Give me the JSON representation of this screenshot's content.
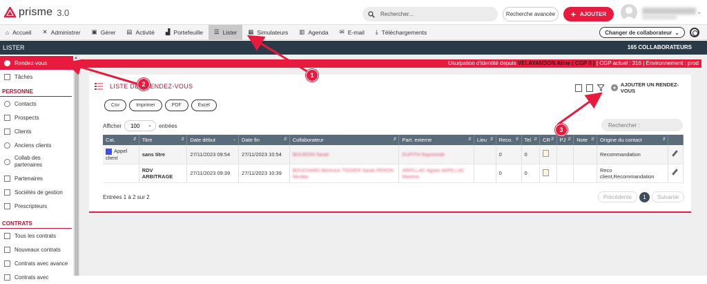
{
  "header": {
    "logo_text": "prisme",
    "version": "3.0",
    "search_placeholder": "Rechercher...",
    "advanced_search": "Recherche avancée",
    "add_label": "AJOUTER"
  },
  "nav": {
    "items": [
      {
        "label": "Accueil",
        "icon": "home-icon"
      },
      {
        "label": "Administrer",
        "icon": "tools-icon"
      },
      {
        "label": "Gérer",
        "icon": "briefcase-icon"
      },
      {
        "label": "Activité",
        "icon": "activity-icon"
      },
      {
        "label": "Portefeuille",
        "icon": "chart-icon"
      },
      {
        "label": "Lister",
        "icon": "list-icon"
      },
      {
        "label": "Simulateurs",
        "icon": "calculator-icon"
      },
      {
        "label": "Agenda",
        "icon": "calendar-icon"
      },
      {
        "label": "E-mail",
        "icon": "envelope-icon"
      },
      {
        "label": "Téléchargements",
        "icon": "download-icon"
      }
    ],
    "active": "Lister",
    "change_collaborator": "Changer de collaborateur"
  },
  "titlebar": {
    "section": "LISTER",
    "count": "165 COLLABORATEURS"
  },
  "alert": {
    "text_prefix": "Usurpation d'identité depuis ",
    "user": "VELAYANDON Aline ( CGP 0 )",
    "text_suffix": " | CGP actuel : 316 | Environnement : prod"
  },
  "sidebar": {
    "items_top": [
      {
        "label": "Rendez-vous",
        "active": true
      },
      {
        "label": "Tâches"
      }
    ],
    "section_personne": "PERSONNE",
    "items_personne": [
      {
        "label": "Contacts"
      },
      {
        "label": "Prospects"
      },
      {
        "label": "Clients"
      },
      {
        "label": "Anciens clients"
      },
      {
        "label": "Collab des partenaires"
      },
      {
        "label": "Partenaires"
      },
      {
        "label": "Sociétés de gestion"
      },
      {
        "label": "Prescripteurs"
      }
    ],
    "section_contrats": "CONTRATS",
    "items_contrats": [
      {
        "label": "Tous les contrats"
      },
      {
        "label": "Nouveaux contrats"
      },
      {
        "label": "Contrats avec avance"
      },
      {
        "label": "Contrats avec"
      }
    ]
  },
  "panel": {
    "title": "LISTE DES RENDEZ-VOUS",
    "add_rdv": "AJOUTER UN RENDEZ-VOUS",
    "exports": [
      "Csv",
      "Imprimer",
      "PDF",
      "Excel"
    ],
    "show_label": "Afficher",
    "show_value": "100",
    "entries_label": "entrées",
    "search_placeholder": "Rechercher :",
    "columns": [
      "Cat.",
      "Titre",
      "Date début",
      "Date fin",
      "Collaborateur",
      "Part. externe",
      "Lieu",
      "Reco.",
      "Tel",
      "CR",
      "PJ",
      "Note",
      "Origine du contact",
      ""
    ],
    "rows": [
      {
        "cat": "Appel client",
        "titre": "sans titre",
        "debut": "27/11/2023 09:54",
        "fin": "27/11/2023 10:54",
        "collab": "BOURDIN Sarah",
        "part": "DUPITH Raymonde",
        "lieu": "",
        "reco": "0",
        "tel": "0",
        "pj": "",
        "note": "",
        "origine": "Recommandation"
      },
      {
        "cat": "",
        "titre": "RDV ARBITRAGE",
        "debut": "27/11/2023 09:39",
        "fin": "27/11/2023 10:39",
        "collab": "BOUCHARD Bérénice TISSIER Sarah PERON Nicolas",
        "part": "ARPILLAC Agnès ARPILLAC Maxime",
        "lieu": "",
        "reco": "0",
        "tel": "0",
        "pj": "",
        "note": "",
        "origine": "Reco client,Recommandation"
      }
    ],
    "footer": "Entrées 1 à 2 sur 2",
    "prev": "Précédente",
    "page": "1",
    "next": "Suivante"
  },
  "annotations": [
    "1",
    "2",
    "3"
  ],
  "colors": {
    "accent": "#e61b3d",
    "dark": "#2b3a48",
    "table_header": "#5a6b7b"
  }
}
